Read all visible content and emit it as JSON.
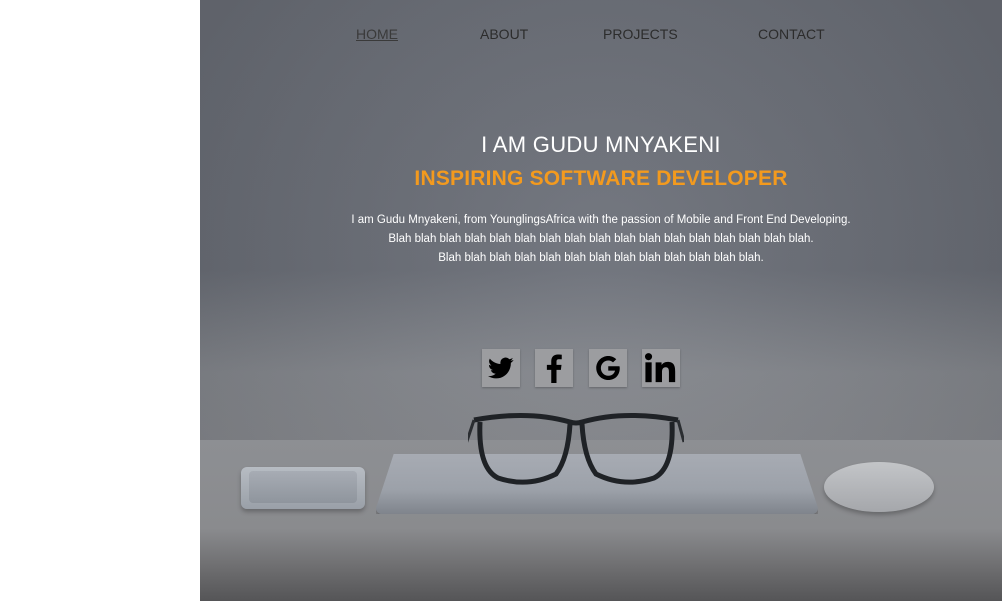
{
  "nav": {
    "items": [
      {
        "label": "HOME",
        "active": true
      },
      {
        "label": "ABOUT",
        "active": false
      },
      {
        "label": "PROJECTS",
        "active": false
      },
      {
        "label": "CONTACT",
        "active": false
      }
    ]
  },
  "hero": {
    "title": "I AM GUDU MNYAKENI",
    "subtitle": "INSPIRING SOFTWARE DEVELOPER",
    "description_lines": [
      "I am Gudu Mnyakeni, from YounglingsAfrica with the passion of Mobile and Front End Developing.",
      "Blah blah blah blah blah blah blah blah blah blah blah blah blah blah blah blah blah.",
      "Blah blah blah blah blah blah blah blah blah blah blah blah blah."
    ]
  },
  "social": [
    {
      "icon": "twitter-icon"
    },
    {
      "icon": "facebook-icon"
    },
    {
      "icon": "google-icon"
    },
    {
      "icon": "linkedin-icon"
    }
  ],
  "colors": {
    "accent": "#f39a1e",
    "title": "#ffffff",
    "nav_text": "#2c2c2c"
  }
}
